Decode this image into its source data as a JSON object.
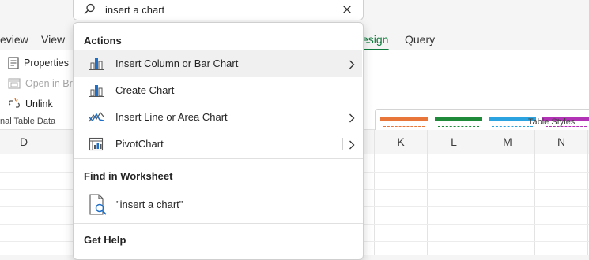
{
  "search": {
    "value": "insert a chart"
  },
  "ribbon": {
    "tabs": [
      {
        "label": "eview"
      },
      {
        "label": "View"
      },
      {
        "label": "esign"
      },
      {
        "label": "Query"
      }
    ],
    "left_group": {
      "items": [
        {
          "label": "Properties"
        },
        {
          "label": "Open in Bro"
        },
        {
          "label": "Unlink"
        }
      ],
      "label": "nal Table Data"
    },
    "styles_group": {
      "label": "Table Styles"
    }
  },
  "sheet": {
    "columns": [
      "D",
      "K",
      "L",
      "M",
      "N"
    ]
  },
  "dropdown": {
    "actions_header": "Actions",
    "actions": [
      {
        "label": "Insert Column or Bar Chart",
        "has_submenu": true
      },
      {
        "label": "Create Chart",
        "has_submenu": false
      },
      {
        "label": "Insert Line or Area Chart",
        "has_submenu": true
      },
      {
        "label": "PivotChart",
        "has_submenu": true
      }
    ],
    "find_header": "Find in Worksheet",
    "find_item": "\"insert a chart\"",
    "help_header": "Get Help"
  },
  "colors": {
    "accent": "#0f7b3e",
    "chart_blue": "#1e6fc7",
    "style_orange": "#e8763a",
    "style_green": "#1f8a3a",
    "style_blue": "#2aa3e0",
    "style_purple": "#b232b6"
  }
}
